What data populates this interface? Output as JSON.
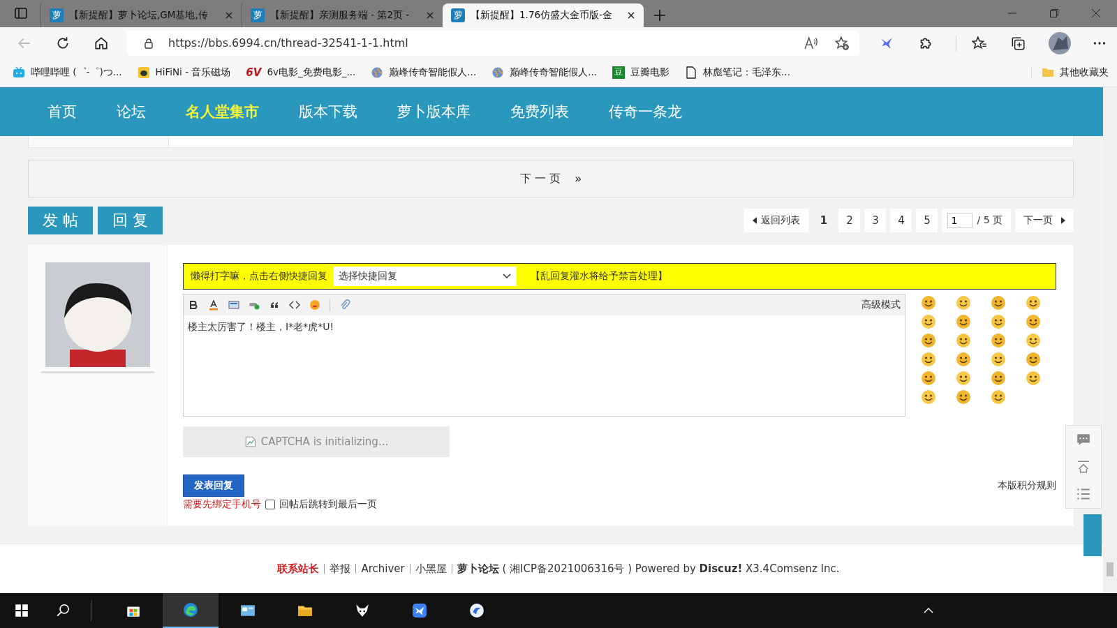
{
  "browser": {
    "tabs": [
      {
        "icon_text": "萝",
        "title": "【新提醒】萝卜论坛,GM基地,传",
        "selected": false
      },
      {
        "icon_text": "萝",
        "title": "【新提醒】亲测服务端 - 第2页 -",
        "selected": false
      },
      {
        "icon_text": "萝",
        "title": "【新提醒】1.76仿盛大金币版-金",
        "selected": true
      }
    ],
    "url": "https://bbs.6994.cn/thread-32541-1-1.html",
    "bookmarks": [
      {
        "kind": "tv",
        "label": "哔哩哔哩 (゜-゜)つ..."
      },
      {
        "kind": "bug",
        "label": "HiFiNi - 音乐磁场"
      },
      {
        "kind": "badge",
        "icon_text": "6V",
        "label": "6v电影_免费电影_..."
      },
      {
        "kind": "globe",
        "label": "巅峰传奇智能假人..."
      },
      {
        "kind": "globe",
        "label": "巅峰传奇智能假人..."
      },
      {
        "kind": "box",
        "icon_text": "豆",
        "label": "豆瓣电影"
      },
      {
        "kind": "page",
        "label": "林彪笔记：毛泽东..."
      }
    ],
    "other_bookmarks": "其他收藏夹"
  },
  "nav": [
    {
      "label": "首页",
      "selected": false
    },
    {
      "label": "论坛",
      "selected": false
    },
    {
      "label": "名人堂集市",
      "selected": true
    },
    {
      "label": "版本下载",
      "selected": false
    },
    {
      "label": "萝卜版本库",
      "selected": false
    },
    {
      "label": "免费列表",
      "selected": false
    },
    {
      "label": "传奇一条龙",
      "selected": false
    }
  ],
  "next_page": {
    "label": "下 一 页",
    "arrow": "»"
  },
  "actions": [
    "发 帖",
    "回 复"
  ],
  "pagination": {
    "back": "返回列表",
    "pages": [
      {
        "label": "1",
        "selected": true
      },
      {
        "label": "2",
        "selected": false
      },
      {
        "label": "3",
        "selected": false
      },
      {
        "label": "4",
        "selected": false
      },
      {
        "label": "5",
        "selected": false
      }
    ],
    "page_input": "1",
    "total": "/ 5 页",
    "next": "下一页"
  },
  "reply": {
    "notice": "懒得打字嘛，点击右侧快捷回复",
    "quick_select": "选择快捷回复",
    "warning": "【乱回复灌水将给予禁言处理】",
    "mode": "高级模式",
    "text": "楼主太厉害了！楼主，I*老*虎*U!",
    "captcha": "CAPTCHA is initializing...",
    "submit": "发表回复",
    "phone_notice": "需要先绑定手机号",
    "jump": {
      "label": "回帖后跳转到最后一页",
      "checked": false
    },
    "rules": "本版积分规则"
  },
  "footer": [
    {
      "kind": "red",
      "text": "联系站长"
    },
    {
      "kind": "plain",
      "text": "举报"
    },
    {
      "kind": "plain",
      "text": "Archiver"
    },
    {
      "kind": "plain",
      "text": "小黑屋"
    },
    {
      "kind": "site",
      "text": "**萝卜论坛** ( 湘ICP备2021006316号 ) Powered by **Discuz!** X3.4Comsenz Inc."
    }
  ]
}
